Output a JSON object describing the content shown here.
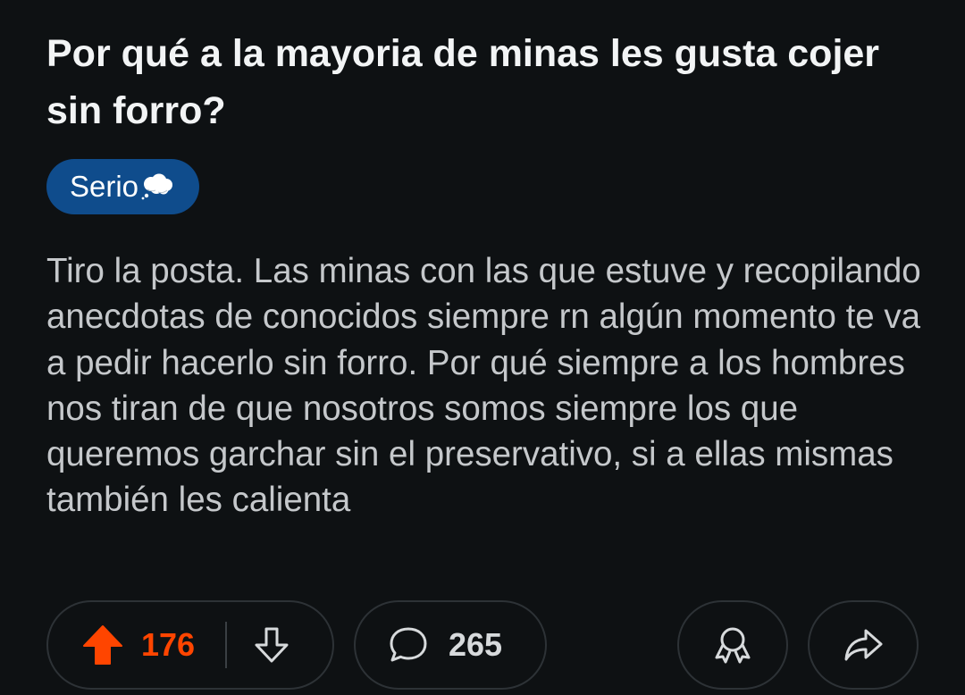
{
  "post": {
    "title": "Por qué a la mayoria de minas les gusta cojer sin forro?",
    "flair": "Serio",
    "flair_icon": "thought-balloon-icon",
    "body": "Tiro la posta. Las minas con las que estuve y recopilando anecdotas de conocidos siempre rn algún momento te va a pedir hacerlo sin forro. Por qué siempre a los hombres nos tiran de que nosotros somos siempre los que queremos garchar sin el preservativo, si a ellas mismas también les calienta"
  },
  "actions": {
    "upvotes": "176",
    "comments": "265",
    "upvote_icon": "upvote-arrow-icon",
    "downvote_icon": "downvote-arrow-icon",
    "comment_icon": "comment-bubble-icon",
    "award_icon": "award-icon",
    "share_icon": "share-arrow-icon"
  },
  "colors": {
    "background": "#0e1113",
    "upvote_active": "#ff4500",
    "flair_bg": "#0f4c8c",
    "title_text": "#f2f4f5",
    "body_text": "#c5c8cb"
  }
}
